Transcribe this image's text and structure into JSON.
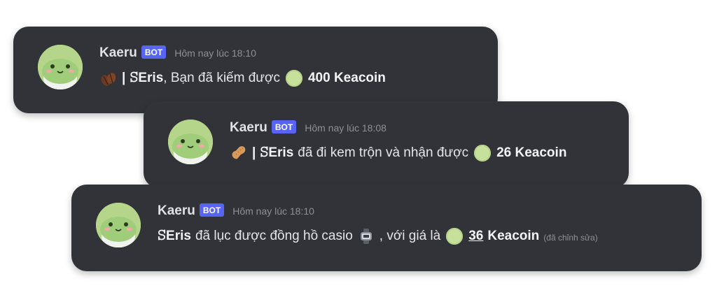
{
  "messages": [
    {
      "username": "Kaeru",
      "badge": "BOT",
      "timestamp": "Hôm nay lúc 18:10",
      "emoji_icon": "coffee-beans-icon",
      "separator": "|",
      "user": "ꕶEris",
      "text": ", Bạn đã kiếm được",
      "coin_icon": "keacoin-icon",
      "amount": "400 Keacoin"
    },
    {
      "username": "Kaeru",
      "badge": "BOT",
      "timestamp": "Hôm nay lúc 18:08",
      "emoji_icon": "peanut-icon",
      "separator": "|",
      "user": "ꕶEris",
      "text": "đã đi kem trộn và nhận được",
      "coin_icon": "keacoin-icon",
      "amount": "26 Keacoin"
    },
    {
      "username": "Kaeru",
      "badge": "BOT",
      "timestamp": "Hôm nay lúc 18:10",
      "user": "ꕶEris",
      "text": "đã lục được đồng hồ casio",
      "item_icon": "wristwatch-icon",
      "text2": ", với giá là",
      "coin_icon": "keacoin-icon",
      "amount_number": "36",
      "amount_unit": "Keacoin",
      "edited": "(đã chỉnh sửa)"
    }
  ],
  "colors": {
    "card_bg": "#313338",
    "bot_badge": "#5865f2",
    "coin": "#c7e19c",
    "avatar_bg": "#c9e2a8"
  }
}
